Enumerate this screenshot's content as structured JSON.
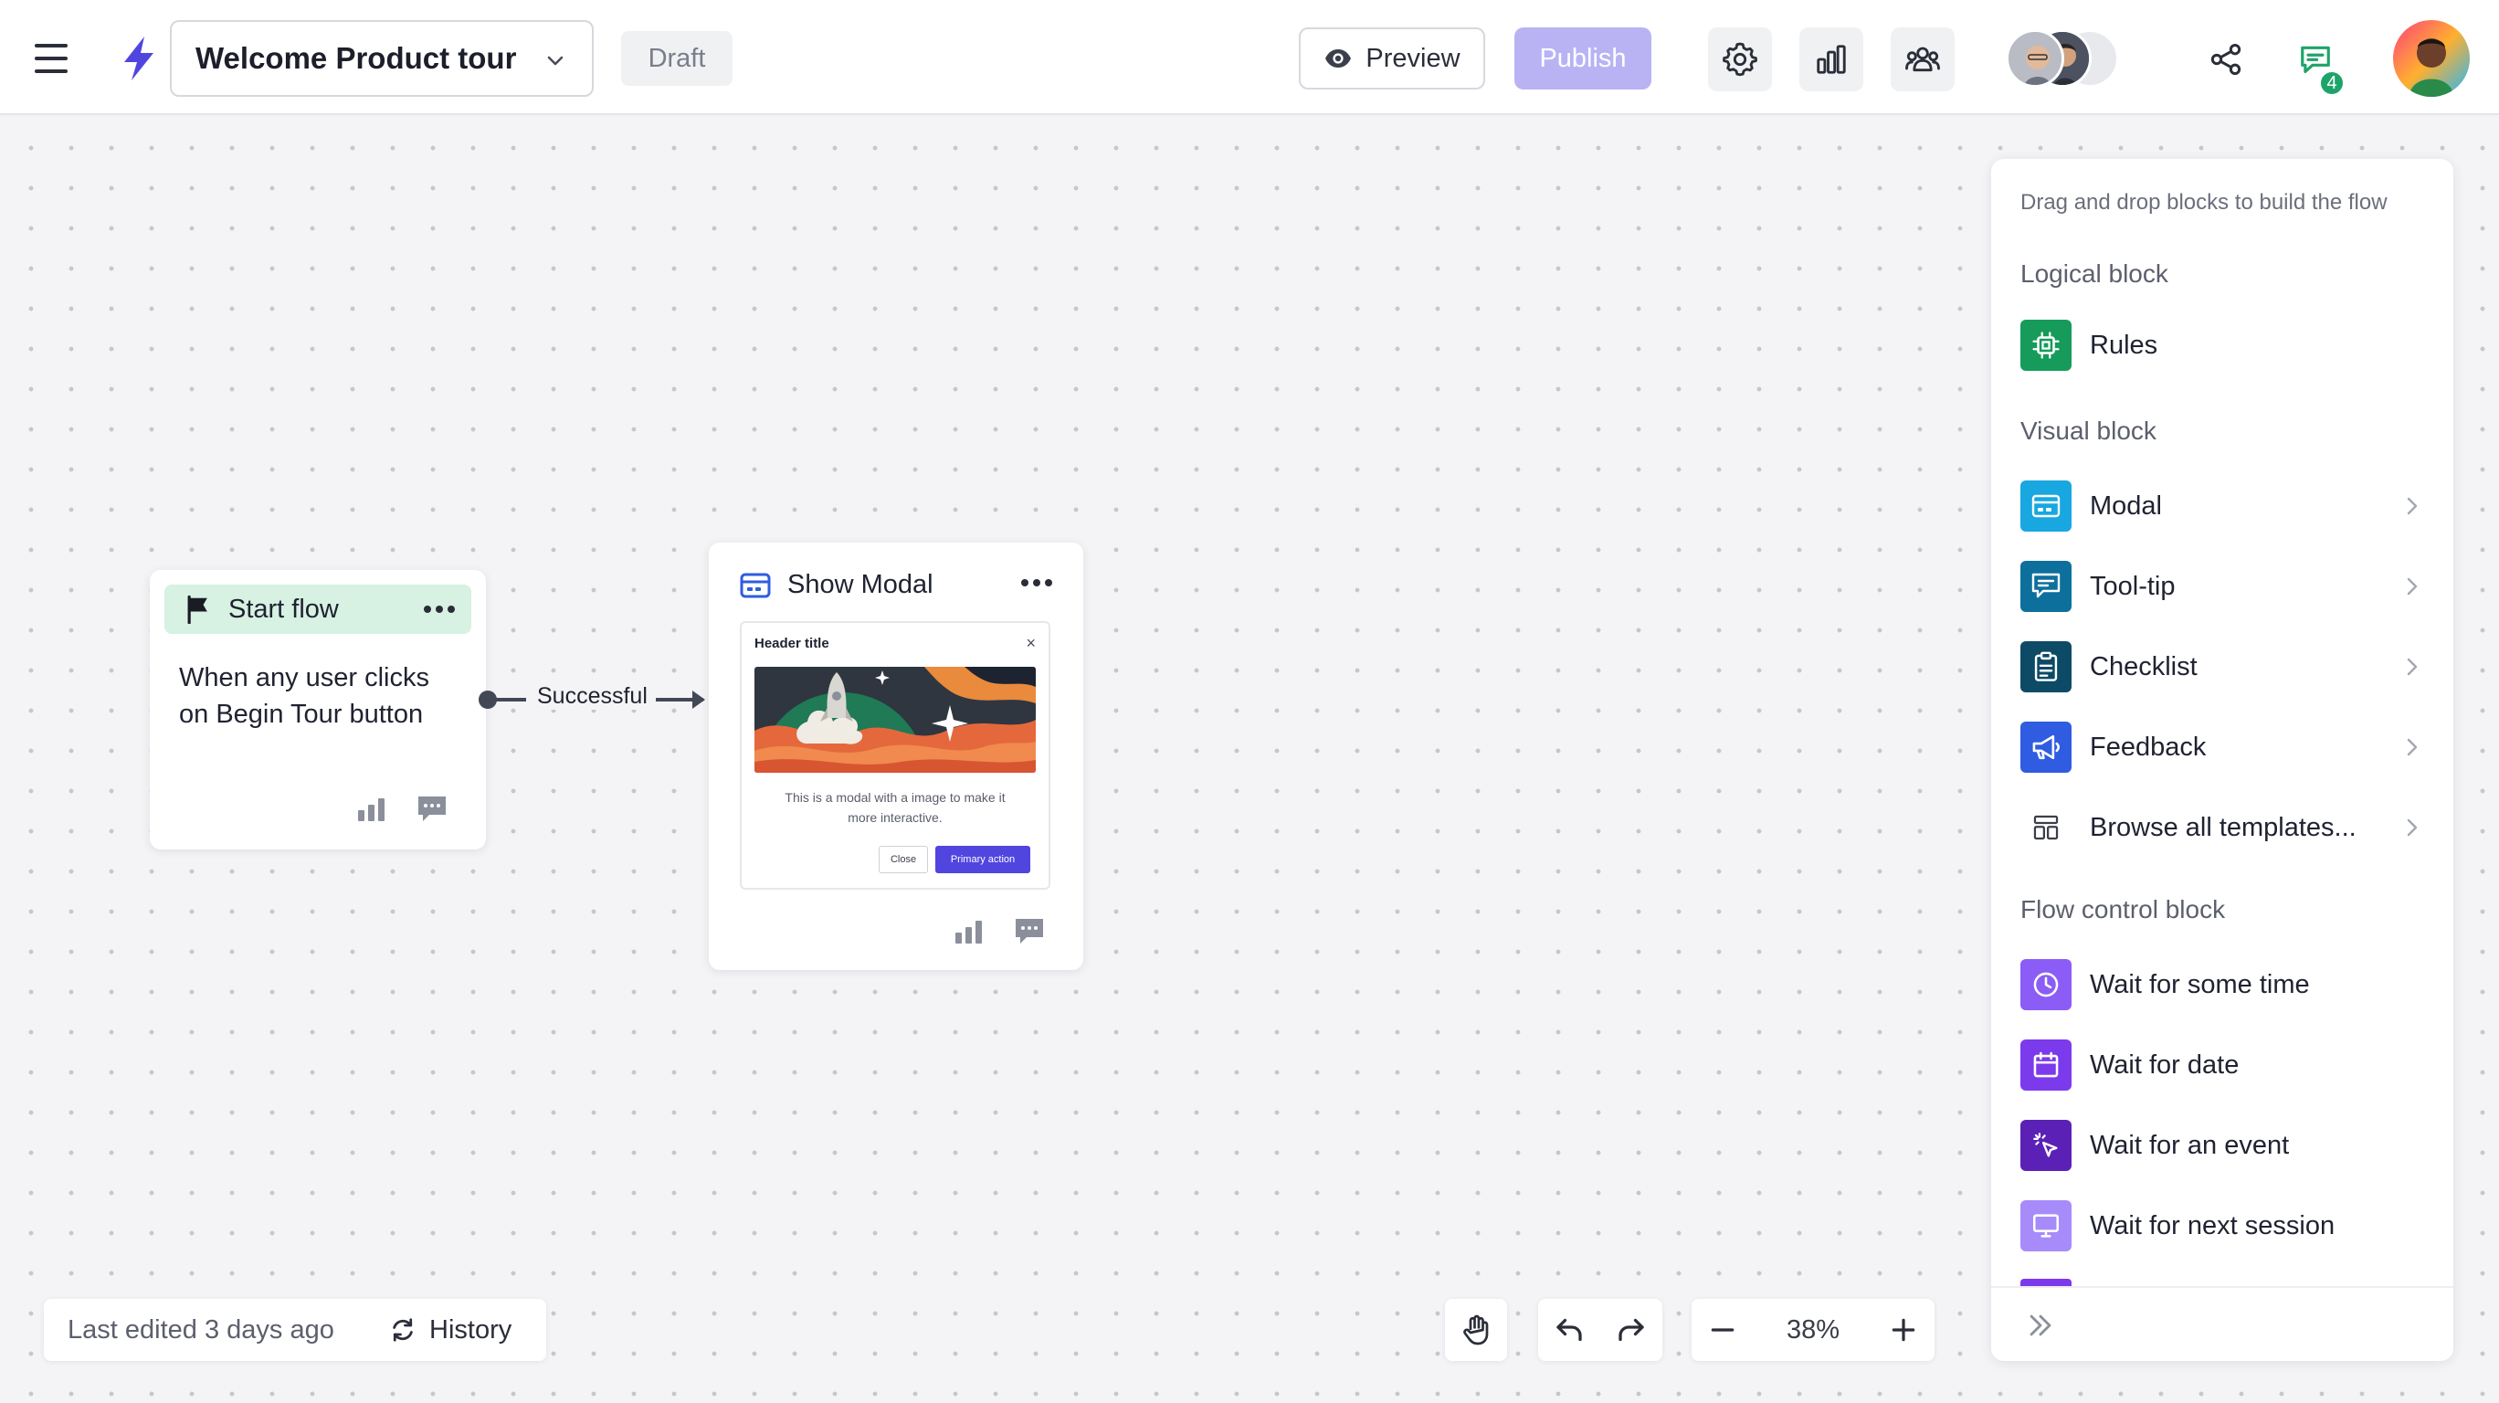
{
  "header": {
    "flow_title": "Welcome Product tour",
    "status": "Draft",
    "preview_label": "Preview",
    "publish_label": "Publish",
    "notification_count": "4"
  },
  "canvas": {
    "start_node": {
      "title": "Start flow",
      "description_line1": "When any user clicks",
      "description_line2": "on Begin Tour button"
    },
    "connector_label": "Successful",
    "modal_node": {
      "title": "Show Modal",
      "preview": {
        "header": "Header title",
        "close_glyph": "×",
        "body_line1": "This is a modal with a image to make it",
        "body_line2": "more interactive.",
        "close_button": "Close",
        "primary_button": "Primary action"
      }
    }
  },
  "panel": {
    "hint": "Drag and drop blocks to build the flow",
    "sections": {
      "logical": "Logical block",
      "visual": "Visual block",
      "flow_control": "Flow control block"
    },
    "logical_items": [
      {
        "label": "Rules",
        "icon": "chip-icon",
        "color": "#169b5b"
      }
    ],
    "visual_items": [
      {
        "label": "Modal",
        "icon": "modal-icon",
        "color": "#18a7e0"
      },
      {
        "label": "Tool-tip",
        "icon": "tooltip-icon",
        "color": "#0d6f9c"
      },
      {
        "label": "Checklist",
        "icon": "clipboard-icon",
        "color": "#0d4a66"
      },
      {
        "label": "Feedback",
        "icon": "megaphone-icon",
        "color": "#2f5ce0"
      },
      {
        "label": "Browse all templates...",
        "icon": "templates-icon",
        "color": "#ffffff"
      }
    ],
    "flow_items": [
      {
        "label": "Wait for some time",
        "icon": "clock-icon",
        "color": "#8b5cf6"
      },
      {
        "label": "Wait for date",
        "icon": "calendar-icon",
        "color": "#7c3aed"
      },
      {
        "label": "Wait for an event",
        "icon": "cursor-click-icon",
        "color": "#5b21b6"
      },
      {
        "label": "Wait for next session",
        "icon": "monitor-icon",
        "color": "#a78bfa"
      }
    ]
  },
  "footer": {
    "last_edited": "Last edited 3 days ago",
    "history_label": "History",
    "zoom": "38%"
  },
  "colors": {
    "accent": "#5145e0",
    "publish_disabled": "#b9b3f4",
    "start_header": "#d7f1e3"
  }
}
